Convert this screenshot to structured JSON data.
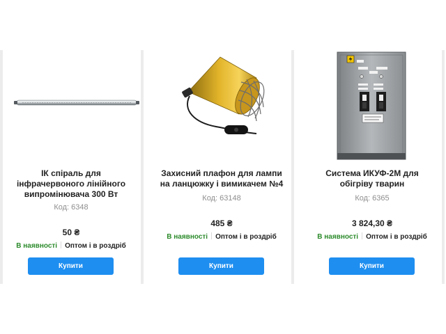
{
  "products": [
    {
      "title": "ІК спіраль для інфрачервоного лінійного випромінювача 300 Вт",
      "code": "Код: 6348",
      "price": "50 ₴",
      "stock": "В наявності",
      "sale": "Оптом і в роздріб",
      "buy_label": "Купити"
    },
    {
      "title": "Захисний плафон для лампи на ланцюжку і вимикачем №4",
      "code": "Код: 63148",
      "price": "485 ₴",
      "stock": "В наявності",
      "sale": "Оптом і в роздріб",
      "buy_label": "Купити"
    },
    {
      "title": "Система ИКУФ-2М для обігріву тварин",
      "code": "Код: 6365",
      "price": "3 824,30 ₴",
      "stock": "В наявності",
      "sale": "Оптом і в роздріб",
      "buy_label": "Купити"
    }
  ],
  "colors": {
    "accent": "#1e8ef0",
    "in_stock": "#2c8b2c",
    "muted": "#8e8e8e",
    "divider": "#ececec"
  },
  "icons": [
    "ir-heater-rod-image",
    "lamp-shade-image",
    "control-cabinet-image",
    "high-voltage-warning-icon"
  ]
}
